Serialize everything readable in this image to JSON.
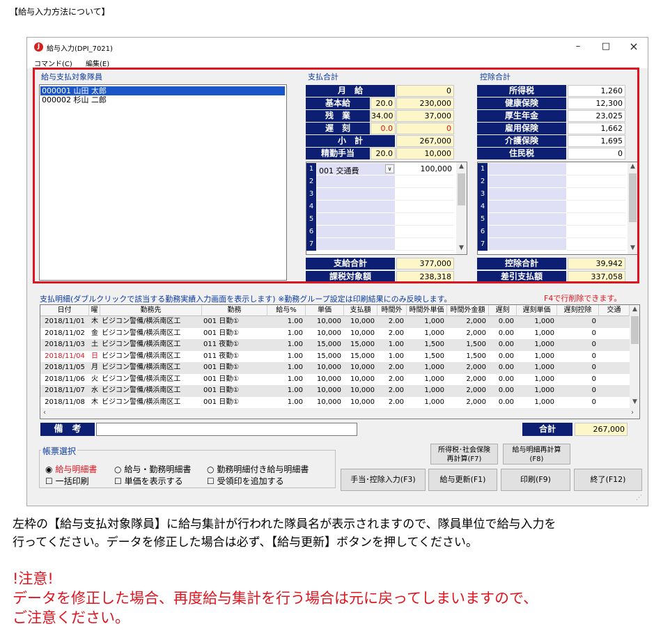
{
  "heading": "【給与入力方法について】",
  "window": {
    "title": "給与入力(DPI_7021)",
    "icon": "app-logo-icon",
    "minimize": "–",
    "maximize": "□",
    "close": "×"
  },
  "menu": [
    "コマンド(C)",
    "編集(E)"
  ],
  "employees": {
    "title": "給与支払対象隊員",
    "items": [
      "000001 山田  太郎",
      "000002 杉山  二郎"
    ]
  },
  "payment": {
    "title": "支払合計",
    "rows": [
      {
        "label": "月　給",
        "qty": "",
        "amount": "0",
        "qty_red": false
      },
      {
        "label": "基本給",
        "qty": "20.0",
        "amount": "230,000",
        "qty_red": false
      },
      {
        "label": "残　業",
        "qty": "34.00",
        "amount": "37,000",
        "qty_red": false
      },
      {
        "label": "遅　刻",
        "qty": "0.0",
        "amount": "0",
        "qty_red": true
      },
      {
        "label": "小　計",
        "qty": "",
        "amount": "267,000",
        "qty_red": false
      },
      {
        "label": "精勤手当",
        "qty": "20.0",
        "amount": "10,000",
        "qty_red": false
      }
    ],
    "allowance_rows": [
      "1",
      "2",
      "3",
      "4",
      "5",
      "6",
      "7"
    ],
    "allowance_first": {
      "code": "001 交通費",
      "amount": "100,000"
    },
    "total_label": "支給合計",
    "total": "377,000",
    "taxable_label": "課税対象額",
    "taxable": "238,318"
  },
  "deduction": {
    "title": "控除合計",
    "rows": [
      {
        "label": "所得税",
        "amount": "1,260"
      },
      {
        "label": "健康保険",
        "amount": "12,300"
      },
      {
        "label": "厚生年金",
        "amount": "23,025"
      },
      {
        "label": "雇用保険",
        "amount": "1,662"
      },
      {
        "label": "介護保険",
        "amount": "1,695"
      },
      {
        "label": "住民税",
        "amount": "0"
      }
    ],
    "rows_num": [
      "1",
      "2",
      "3",
      "4",
      "5",
      "6",
      "7"
    ],
    "total_label": "控除合計",
    "total": "39,942",
    "net_label": "差引支払額",
    "net": "337,058"
  },
  "detail": {
    "title": "支払明細(ダブルクリックで該当する勤務実績入力画面を表示します) ※勤務グループ設定は印刷結果にのみ反映します。",
    "note": "F4で行削除できます。",
    "headers": [
      "日付",
      "曜",
      "勤務先",
      "勤務",
      "給与%",
      "単価",
      "支払額",
      "時間外",
      "時間外単価",
      "時間外金額",
      "遅刻",
      "遅刻単価",
      "遅刻控除",
      "交通"
    ],
    "rows": [
      [
        "2018/11/01",
        "木",
        "ビジコン警備/横浜南区工",
        "001 日勤①",
        "1.00",
        "10,000",
        "10,000",
        "2.00",
        "1,000",
        "2,000",
        "0.00",
        "1,000",
        "0",
        ""
      ],
      [
        "2018/11/02",
        "金",
        "ビジコン警備/横浜南区工",
        "001 日勤①",
        "1.00",
        "10,000",
        "10,000",
        "2.00",
        "1,000",
        "2,000",
        "0.00",
        "1,000",
        "0",
        ""
      ],
      [
        "2018/11/03",
        "土",
        "ビジコン警備/横浜南区工",
        "011 夜勤①",
        "1.00",
        "15,000",
        "15,000",
        "1.00",
        "1,500",
        "1,500",
        "0.00",
        "1,000",
        "0",
        ""
      ],
      [
        "2018/11/04",
        "日",
        "ビジコン警備/横浜南区工",
        "011 夜勤①",
        "1.00",
        "15,000",
        "15,000",
        "1.00",
        "1,500",
        "1,500",
        "0.00",
        "1,000",
        "0",
        ""
      ],
      [
        "2018/11/05",
        "月",
        "ビジコン警備/横浜南区工",
        "001 日勤①",
        "1.00",
        "10,000",
        "10,000",
        "2.00",
        "1,000",
        "2,000",
        "0.00",
        "1,000",
        "0",
        ""
      ],
      [
        "2018/11/06",
        "火",
        "ビジコン警備/横浜南区工",
        "001 日勤①",
        "1.00",
        "10,000",
        "10,000",
        "2.00",
        "1,000",
        "2,000",
        "0.00",
        "1,000",
        "0",
        ""
      ],
      [
        "2018/11/07",
        "水",
        "ビジコン警備/横浜南区工",
        "001 日勤①",
        "1.00",
        "10,000",
        "10,000",
        "2.00",
        "1,000",
        "2,000",
        "0.00",
        "1,000",
        "0",
        ""
      ],
      [
        "2018/11/08",
        "木",
        "ビジコン警備/横浜南区工",
        "001 日勤①",
        "1.00",
        "10,000",
        "10,000",
        "2.00",
        "1,000",
        "2,000",
        "0.00",
        "1,000",
        "0",
        ""
      ]
    ],
    "holiday_row_index": 3
  },
  "remarks": {
    "label": "備　考",
    "value": ""
  },
  "sum": {
    "label": "合計",
    "value": "267,000"
  },
  "forms": {
    "title": "帳票選択",
    "radios": [
      "給与明細書",
      "給与・勤務明細書",
      "勤務明細付き給与明細書"
    ],
    "selected": 0,
    "checks": [
      "一括印刷",
      "単価を表示する",
      "受領印を追加する"
    ]
  },
  "buttons": {
    "recalc_tax": "所得税･社会保険\n再計算(F7)",
    "recalc_slip": "給与明細再計算\n(F8)",
    "allowance": "手当･控除入力(F3)",
    "update": "給与更新(F1)",
    "print": "印刷(F9)",
    "exit": "終了(F12)"
  },
  "instructions": {
    "line1": "左枠の【給与支払対象隊員】に給与集計が行われた隊員名が表示されますので、隊員単位で給与入力を",
    "line2": "行ってください。データを修正した場合は必ず、【給与更新】ボタンを押してください。",
    "warn1": "!注意!",
    "warn2": "データを修正した場合、再度給与集計を行う場合は元に戻ってしまいますので、",
    "warn3": "ご注意ください。"
  },
  "colors": {
    "label_bg": "#0c1f72",
    "value_bg": "#fdf6c8",
    "highlight": "#e0141e",
    "select": "#1a56c8"
  }
}
